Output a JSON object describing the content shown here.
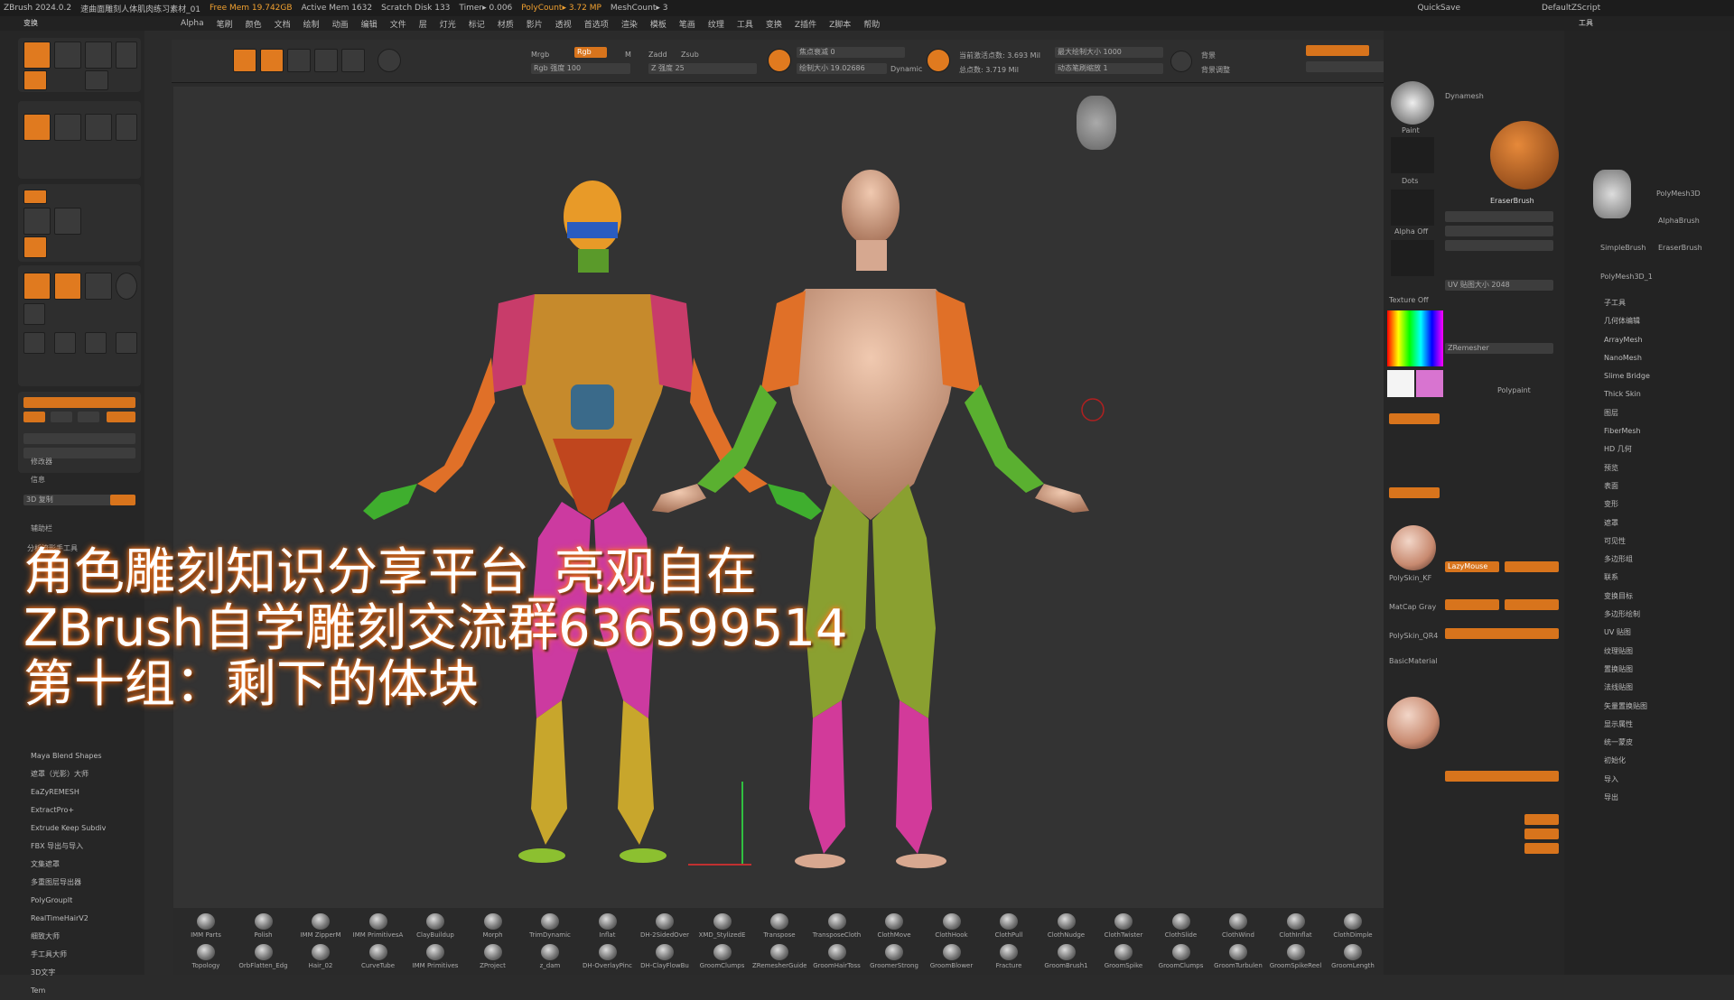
{
  "menubar": {
    "app": "ZBrush 2024.0.2",
    "doc": "速曲面雕刻人体肌肉练习素材_01",
    "free_mem": "Free Mem 19.742GB",
    "active_mem": "Active Mem 1632",
    "scratch": "Scratch Disk 133",
    "timer": "Timer▸ 0.006",
    "polycount": "PolyCount▸ 3.72 MP",
    "meshcount": "MeshCount▸ 3",
    "quicksave": "QuickSave",
    "script": "DefaultZScript"
  },
  "menus": [
    "Alpha",
    "笔刷",
    "颜色",
    "文档",
    "绘制",
    "动画",
    "编辑",
    "文件",
    "层",
    "灯光",
    "标记",
    "材质",
    "影片",
    "透视",
    "首选项",
    "渲染",
    "模板",
    "笔画",
    "纹理",
    "工具",
    "变换",
    "Z插件",
    "Z脚本",
    "帮助"
  ],
  "left_panel": {
    "title": "变换",
    "items": [
      "修改器",
      "信息",
      "3D 复制",
      "辅助栏",
      "分析流形手工具"
    ],
    "plugins": [
      "Maya Blend Shapes",
      "遮罩（光影）大师",
      "EaZyREMESH",
      "ExtractPro+",
      "Extrude Keep Subdiv",
      "FBX 导出与导入",
      "文集遮罩",
      "多重图层导出器",
      "PolyGroupIt",
      "RealTimeHairV2",
      "细致大师",
      "手工具大师",
      "3D文字",
      "Tem"
    ]
  },
  "top_shelf": {
    "rgb": "Rgb",
    "rgb_intensity": "Rgb 强度 100",
    "zadd": "Zadd",
    "zsub": "Zsub",
    "z_intensity": "Z 强度 25",
    "focal": "焦点衰减 0",
    "draw_size": "绘制大小 19.02686",
    "dynamic": "Dynamic",
    "active_points": "当前激活点数: 3.693 Mil",
    "total_points": "总点数: 3.719 Mil",
    "max_draw": "最大绘制大小 1000",
    "spotlight": "动态笔刷缩放 1",
    "floor": "背景",
    "persp": "背景调整"
  },
  "right_panel": {
    "dynamesh": "Dynamesh",
    "paint": "Paint",
    "dots": "Dots",
    "alpha_off": "Alpha Off",
    "texture_off": "Texture Off",
    "brush_name": "EraserBrush",
    "zremesher": "ZRemesher",
    "mat1": "PolySkin_KF",
    "mat2": "MatCap Gray",
    "mat3": "PolySkin_QR4",
    "mat4": "BasicMaterial",
    "uv_size": "UV 贴图大小 2048",
    "lazymouse": "LazyMouse",
    "polypaint": "Polypaint"
  },
  "tool_panel": {
    "title": "工具",
    "tools": [
      "PolyMesh3D",
      "AlphaBrush",
      "SimpleBrush",
      "EraserBrush",
      "PolyMesh3D_1"
    ],
    "list": [
      "子工具",
      "几何体编辑",
      "ArrayMesh",
      "NanoMesh",
      "Slime Bridge",
      "Thick Skin",
      "图层",
      "FiberMesh",
      "HD 几何",
      "预览",
      "表面",
      "变形",
      "遮罩",
      "可见性",
      "多边形组",
      "联系",
      "变换目标",
      "多边形绘制",
      "UV 贴图",
      "纹理贴图",
      "置换贴图",
      "法线贴图",
      "矢量置换贴图",
      "显示属性",
      "统一蒙皮",
      "初始化",
      "导入",
      "导出"
    ]
  },
  "bottom_brushes_row1": [
    "IMM Parts",
    "Polish",
    "IMM ZipperM",
    "IMM PrimitivesA",
    "ClayBuildup",
    "Morph",
    "TrimDynamic",
    "Inflat",
    "DH-2SidedOver",
    "XMD_StylizedE",
    "Transpose",
    "TransposeCloth",
    "ClothMove",
    "ClothHook",
    "ClothPull",
    "ClothNudge",
    "ClothTwister",
    "ClothSlide",
    "ClothWind",
    "ClothInflat",
    "ClothDimple"
  ],
  "bottom_brushes_row2": [
    "Topology",
    "OrbFlatten_Edg",
    "Hair_02",
    "CurveTube",
    "IMM Primitives",
    "ZProject",
    "z_dam",
    "DH-OverlayPinc",
    "DH-ClayFlowBu",
    "GroomClumps",
    "ZRemesherGuide",
    "GroomHairToss",
    "GroomerStrong",
    "GroomBlower",
    "Fracture",
    "GroomBrush1",
    "GroomSpike",
    "GroomClumps",
    "GroomTurbulen",
    "GroomSpikeReel",
    "GroomLength"
  ],
  "overlay": {
    "line1": "角色雕刻知识分享平台_亮观自在",
    "line2": "ZBrush自学雕刻交流群636599514",
    "line3": "第十组：剩下的体块"
  },
  "colors": {
    "accent": "#e07a1f",
    "bg": "#2b2b2b",
    "canvas": "#333333"
  }
}
